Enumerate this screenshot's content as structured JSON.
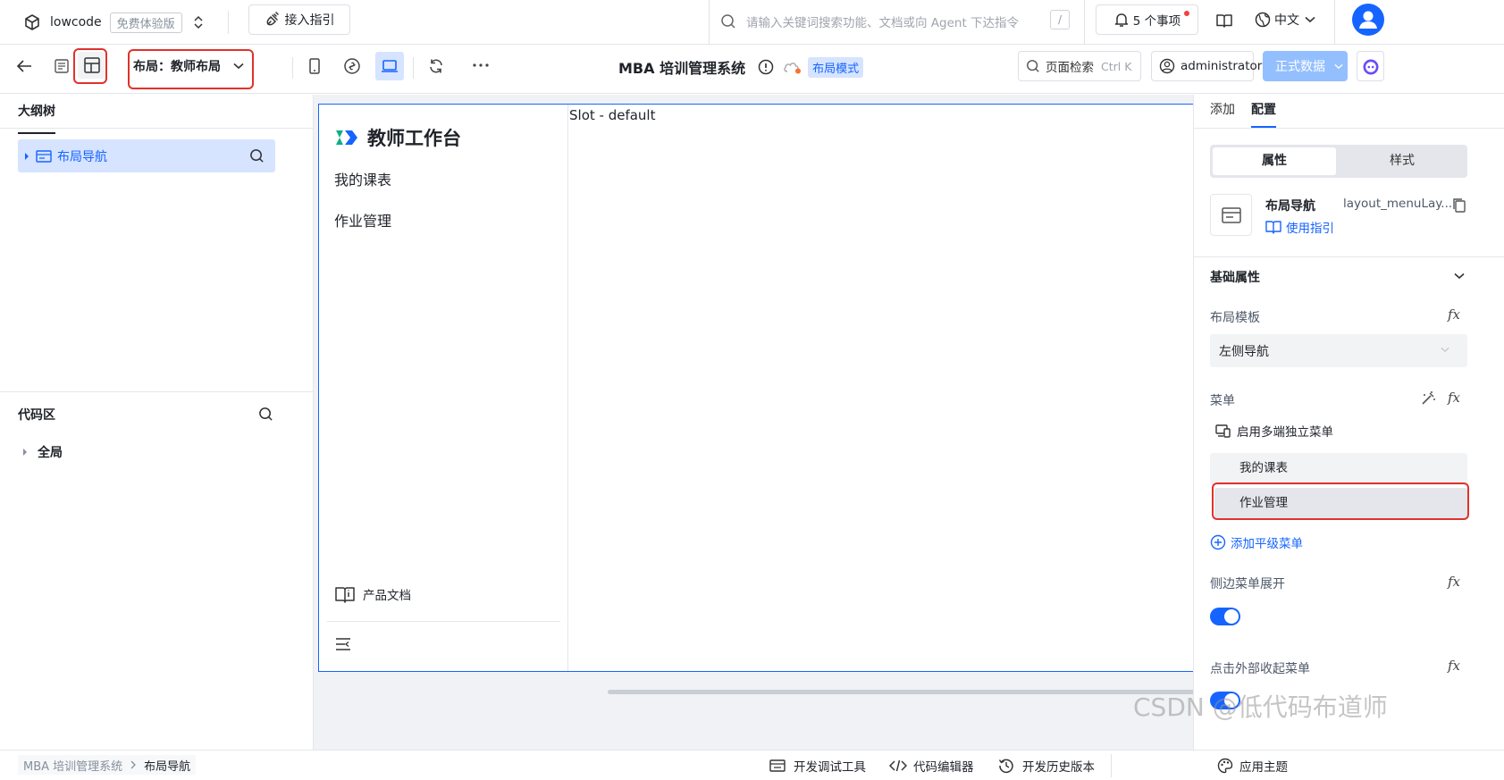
{
  "topbar": {
    "app_name": "lowcode",
    "edition_badge": "免费体验版",
    "guide_button": "接入指引",
    "search_placeholder": "请输入关键词搜索功能、文档或向 Agent 下达指令",
    "search_shortcut": "/",
    "todo_label": "5 个事项",
    "language": "中文"
  },
  "toolbar": {
    "layout_selector": "布局：教师布局",
    "app_title": "MBA 培训管理系统",
    "mode_badge": "布局模式",
    "page_search": "页面检索",
    "page_search_shortcut": "Ctrl K",
    "user": "administrator",
    "publish_button": "正式数据"
  },
  "outline": {
    "title": "大纲树",
    "node_label": "布局导航"
  },
  "code_area": {
    "title": "代码区",
    "global_item": "全局"
  },
  "canvas": {
    "brand_title": "教师工作台",
    "menu": [
      "我的课表",
      "作业管理"
    ],
    "slot_text": "Slot - default",
    "docs_link": "产品文档"
  },
  "rightpanel": {
    "tabs": [
      "添加",
      "配置"
    ],
    "segment": [
      "属性",
      "样式"
    ],
    "component_name": "布局导航",
    "component_id": "layout_menuLay...",
    "usage_guide": "使用指引",
    "basic_props": "基础属性",
    "layout_template_label": "布局模板",
    "layout_template_value": "左侧导航",
    "menu_label": "菜单",
    "multi_terminal": "启用多端独立菜单",
    "menu_items": [
      "我的课表",
      "作业管理"
    ],
    "add_menu": "添加平级菜单",
    "side_expand_label": "侧边菜单展开",
    "side_expand_on": true,
    "collapse_label": "点击外部收起菜单",
    "fx": "fx"
  },
  "statusbar": {
    "breadcrumb": [
      "MBA 培训管理系统",
      "布局导航"
    ],
    "dev_tools": "开发调试工具",
    "code_editor": "代码编辑器",
    "history": "开发历史版本",
    "theme": "应用主题",
    "watermark": "CSDN @低代码布道师"
  },
  "colors": {
    "primary": "#1664ff",
    "highlight": "#d6e4ff",
    "red_annotation": "#e0322a",
    "publish_bg": "#94bfff"
  }
}
